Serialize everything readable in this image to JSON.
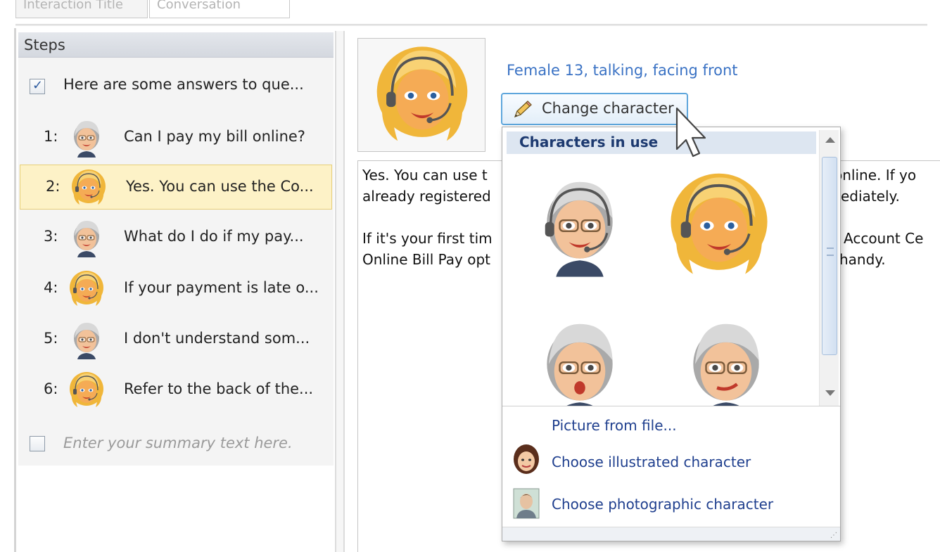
{
  "tabs": [
    "Interaction Title",
    "Conversation"
  ],
  "steps": {
    "header": "Steps",
    "intro": {
      "checked": true,
      "text": "Here are some answers to que..."
    },
    "items": [
      {
        "num": "1:",
        "character": "gray-hair-woman",
        "text": "Can I pay my bill online?",
        "selected": false
      },
      {
        "num": "2:",
        "character": "blonde-woman",
        "text": "Yes. You can use the Co...",
        "selected": true
      },
      {
        "num": "3:",
        "character": "gray-hair-woman",
        "text": "What do I do if my pay...",
        "selected": false
      },
      {
        "num": "4:",
        "character": "blonde-woman",
        "text": "If your payment is late o...",
        "selected": false
      },
      {
        "num": "5:",
        "character": "gray-hair-woman",
        "text": "I don't understand som...",
        "selected": false
      },
      {
        "num": "6:",
        "character": "blonde-woman",
        "text": "Refer to the back of the...",
        "selected": false
      }
    ],
    "summary": {
      "checked": false,
      "placeholder": "Enter your summary text here."
    }
  },
  "editor": {
    "character_description": "Female 13,  talking,  facing front",
    "change_button_label": "Change character",
    "body_lines": [
      "Yes. You can use t",
      "already registered",
      "",
      "If it's your first tim",
      "Online Bill Pay opt"
    ],
    "body_lines_right": [
      "online. If yo",
      "ediately.",
      "",
      "Account Ce",
      "handy."
    ]
  },
  "dropdown": {
    "header": "Characters in use",
    "characters": [
      "gray-hair-woman-headset",
      "blonde-woman-headset",
      "gray-hair-woman-surprised",
      "gray-hair-woman-smirk"
    ],
    "options": [
      {
        "label": "Picture from file...",
        "icon": ""
      },
      {
        "label": "Choose illustrated character",
        "icon": "illustrated-character-icon"
      },
      {
        "label": "Choose photographic character",
        "icon": "photographic-character-icon"
      }
    ]
  },
  "colors": {
    "link_blue": "#3a72c4",
    "selection_bg": "#fdf2c7",
    "header_text": "#1d3a70",
    "option_text": "#1f3f8e"
  }
}
